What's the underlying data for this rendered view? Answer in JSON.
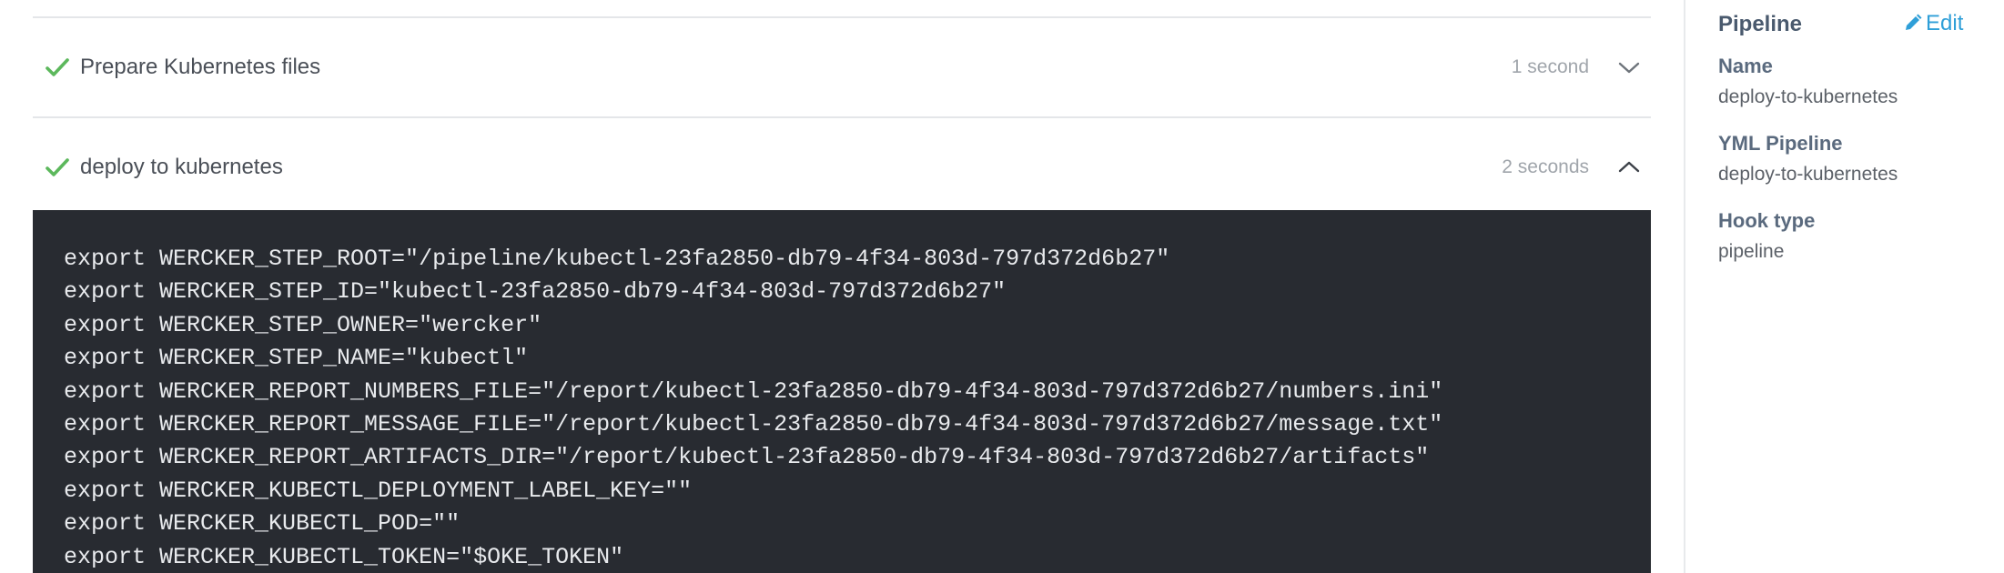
{
  "steps": [
    {
      "title": "Prepare Kubernetes files",
      "duration": "1 second",
      "status": "passed",
      "expanded": false
    },
    {
      "title": "deploy to kubernetes",
      "duration": "2 seconds",
      "status": "passed",
      "expanded": true
    }
  ],
  "log": {
    "lines": [
      "export WERCKER_STEP_ROOT=\"/pipeline/kubectl-23fa2850-db79-4f34-803d-797d372d6b27\"",
      "export WERCKER_STEP_ID=\"kubectl-23fa2850-db79-4f34-803d-797d372d6b27\"",
      "export WERCKER_STEP_OWNER=\"wercker\"",
      "export WERCKER_STEP_NAME=\"kubectl\"",
      "export WERCKER_REPORT_NUMBERS_FILE=\"/report/kubectl-23fa2850-db79-4f34-803d-797d372d6b27/numbers.ini\"",
      "export WERCKER_REPORT_MESSAGE_FILE=\"/report/kubectl-23fa2850-db79-4f34-803d-797d372d6b27/message.txt\"",
      "export WERCKER_REPORT_ARTIFACTS_DIR=\"/report/kubectl-23fa2850-db79-4f34-803d-797d372d6b27/artifacts\"",
      "export WERCKER_KUBECTL_DEPLOYMENT_LABEL_KEY=\"\"",
      "export WERCKER_KUBECTL_POD=\"\"",
      "export WERCKER_KUBECTL_TOKEN=\"$OKE_TOKEN\""
    ]
  },
  "sidebar": {
    "title": "Pipeline",
    "edit_label": "Edit",
    "fields": [
      {
        "label": "Name",
        "value": "deploy-to-kubernetes"
      },
      {
        "label": "YML Pipeline",
        "value": "deploy-to-kubernetes"
      },
      {
        "label": "Hook type",
        "value": "pipeline"
      }
    ]
  },
  "colors": {
    "success": "#5cb85c",
    "log_background": "#282b31",
    "link": "#2f9fd8"
  },
  "icons": {
    "status": "check-icon",
    "collapsed": "chevron-down-icon",
    "expanded": "chevron-up-icon",
    "edit": "pencil-icon"
  }
}
